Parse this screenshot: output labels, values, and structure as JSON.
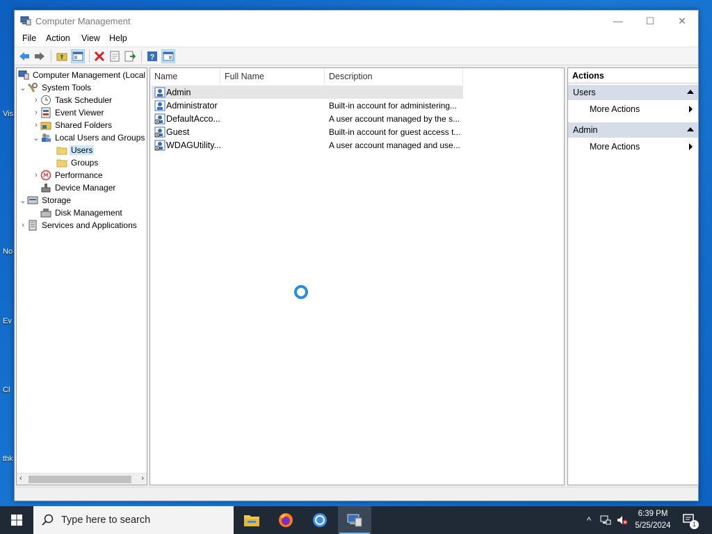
{
  "desktop": {
    "fragments": [
      "Vis",
      "No",
      "Ev",
      "Cl",
      "thk"
    ]
  },
  "window": {
    "title": "Computer Management",
    "controls": {
      "minimize": "—",
      "maximize": "☐",
      "close": "✕"
    }
  },
  "menu": [
    "File",
    "Action",
    "View",
    "Help"
  ],
  "tree": {
    "root": "Computer Management (Local",
    "system_tools": "System Tools",
    "task_scheduler": "Task Scheduler",
    "event_viewer": "Event Viewer",
    "shared_folders": "Shared Folders",
    "local_users_groups": "Local Users and Groups",
    "users": "Users",
    "groups": "Groups",
    "performance": "Performance",
    "device_manager": "Device Manager",
    "storage": "Storage",
    "disk_management": "Disk Management",
    "services_apps": "Services and Applications"
  },
  "list": {
    "columns": [
      "Name",
      "Full Name",
      "Description"
    ],
    "rows": [
      {
        "name": "Admin",
        "full_name": "",
        "description": ""
      },
      {
        "name": "Administrator",
        "full_name": "",
        "description": "Built-in account for administering..."
      },
      {
        "name": "DefaultAcco...",
        "full_name": "",
        "description": "A user account managed by the s..."
      },
      {
        "name": "Guest",
        "full_name": "",
        "description": "Built-in account for guest access t..."
      },
      {
        "name": "WDAGUtility...",
        "full_name": "",
        "description": "A user account managed and use..."
      }
    ]
  },
  "actions": {
    "header": "Actions",
    "section1": "Users",
    "section1_item": "More Actions",
    "section2": "Admin",
    "section2_item": "More Actions"
  },
  "taskbar": {
    "search_placeholder": "Type here to search",
    "time": "6:39 PM",
    "date": "5/25/2024",
    "notification_count": "1"
  },
  "colors": {
    "accent": "#2a8ee0",
    "selection": "#cce8ff",
    "section_header": "#d4dde8",
    "taskbar": "#1f2a36"
  }
}
